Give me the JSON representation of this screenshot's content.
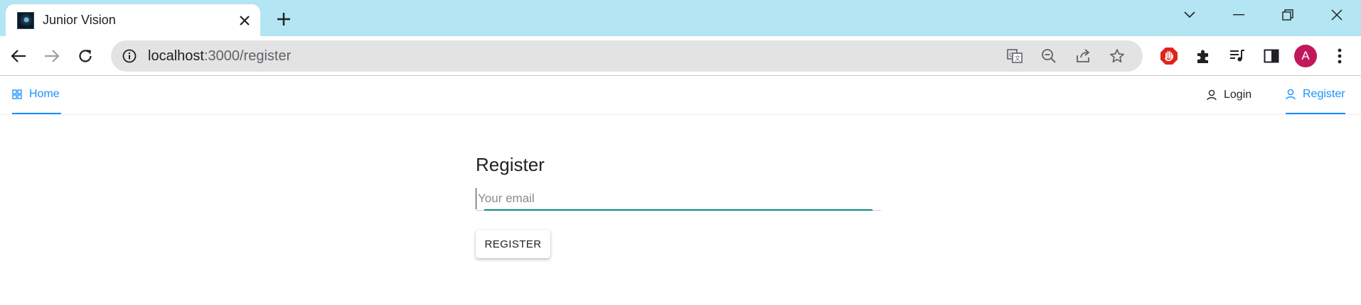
{
  "browser": {
    "tab": {
      "title": "Junior Vision",
      "favicon": "app-favicon"
    },
    "new_tab_label": "+",
    "window_controls": [
      "chevron-down-icon",
      "minimize-icon",
      "restore-icon",
      "close-icon"
    ],
    "address": {
      "host": "localhost",
      "path": ":3000/register"
    },
    "omnibox_actions": [
      "translate-icon",
      "zoom-out-icon",
      "share-icon",
      "star-icon"
    ],
    "extensions": [
      "adblock-icon",
      "puzzle-icon",
      "media-icon",
      "sidepanel-icon"
    ],
    "profile_initial": "A",
    "colors": {
      "tabstrip": "#b3e5f2",
      "avatar": "#c2185b",
      "adblock": "#e0241b"
    }
  },
  "nav": {
    "home": {
      "label": "Home",
      "icon": "grid-icon",
      "active": true
    },
    "login": {
      "label": "Login",
      "icon": "user-icon"
    },
    "register": {
      "label": "Register",
      "icon": "user-icon",
      "active": true
    },
    "accent": "#1890ff"
  },
  "form": {
    "title": "Register",
    "email_placeholder": "Your email",
    "email_value": "",
    "submit_label": "REGISTER",
    "focus_color": "#0f8a7e"
  }
}
